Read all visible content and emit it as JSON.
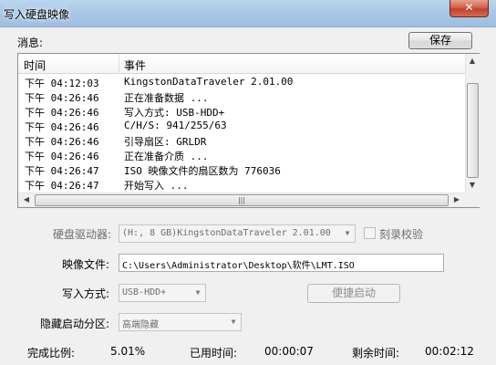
{
  "window": {
    "title": "写入硬盘映像",
    "close_label": "✕"
  },
  "messages": {
    "label": "消息:",
    "save_label": "保存"
  },
  "log": {
    "columns": {
      "time": "时间",
      "event": "事件"
    },
    "rows": [
      {
        "time": "下午 04:12:03",
        "event": "KingstonDataTraveler 2.01.00"
      },
      {
        "time": "下午 04:26:46",
        "event": "正在准备数据 ..."
      },
      {
        "time": "下午 04:26:46",
        "event": "写入方式: USB-HDD+"
      },
      {
        "time": "下午 04:26:46",
        "event": "C/H/S: 941/255/63"
      },
      {
        "time": "下午 04:26:46",
        "event": "引导扇区: GRLDR"
      },
      {
        "time": "下午 04:26:46",
        "event": "正在准备介质 ..."
      },
      {
        "time": "下午 04:26:47",
        "event": "ISO 映像文件的扇区数为 776036"
      },
      {
        "time": "下午 04:26:47",
        "event": "开始写入 ..."
      }
    ],
    "hscroll_grip": "|||"
  },
  "form": {
    "drive_label": "硬盘驱动器:",
    "drive_value": "(H:, 8 GB)KingstonDataTraveler 2.01.00",
    "verify_label": "刻录校验",
    "image_label": "映像文件:",
    "image_value": "C:\\Users\\Administrator\\Desktop\\软件\\LMT.ISO",
    "mode_label": "写入方式:",
    "mode_value": "USB-HDD+",
    "quickboot_label": "便捷启动",
    "hidden_label": "隐藏启动分区:",
    "hidden_value": "高端隐藏"
  },
  "status": {
    "progress_label": "完成比例:",
    "progress_value": "5.01%",
    "elapsed_label": "已用时间:",
    "elapsed_value": "00:00:07",
    "remaining_label": "剩余时间:",
    "remaining_value": "00:02:12"
  }
}
